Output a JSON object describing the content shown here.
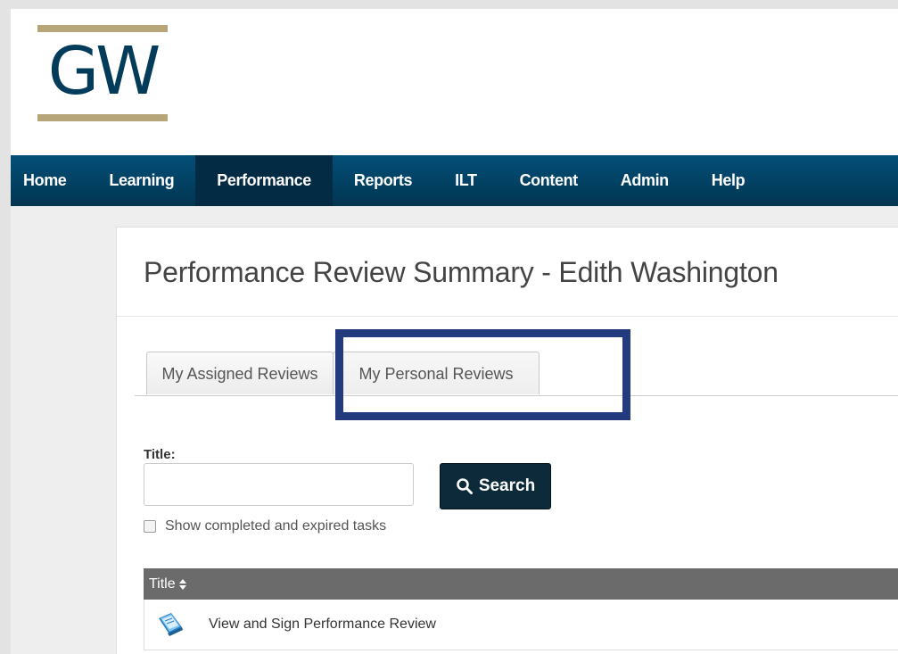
{
  "logo": {
    "text": "GW",
    "bar_color": "#b7a57a",
    "text_color": "#033c5a"
  },
  "nav": {
    "items": [
      {
        "label": "Home"
      },
      {
        "label": "Learning"
      },
      {
        "label": "Performance",
        "active": true
      },
      {
        "label": "Reports"
      },
      {
        "label": "ILT"
      },
      {
        "label": "Content"
      },
      {
        "label": "Admin"
      },
      {
        "label": "Help"
      }
    ]
  },
  "page": {
    "title": "Performance Review Summary - Edith Washington"
  },
  "tabs": [
    {
      "label": "My Assigned Reviews"
    },
    {
      "label": "My Personal Reviews",
      "highlighted": true
    }
  ],
  "highlight_color": "#243a7e",
  "filter": {
    "title_label": "Title:",
    "title_value": "",
    "search_label": "Search",
    "search_icon": "search-icon",
    "checkbox_label": "Show completed and expired tasks",
    "checkbox_checked": false
  },
  "table": {
    "column_title": "Title",
    "sort_icon": "sort-icon",
    "rows": [
      {
        "title": "View and Sign Performance Review",
        "icon": "review-document-icon"
      }
    ]
  }
}
